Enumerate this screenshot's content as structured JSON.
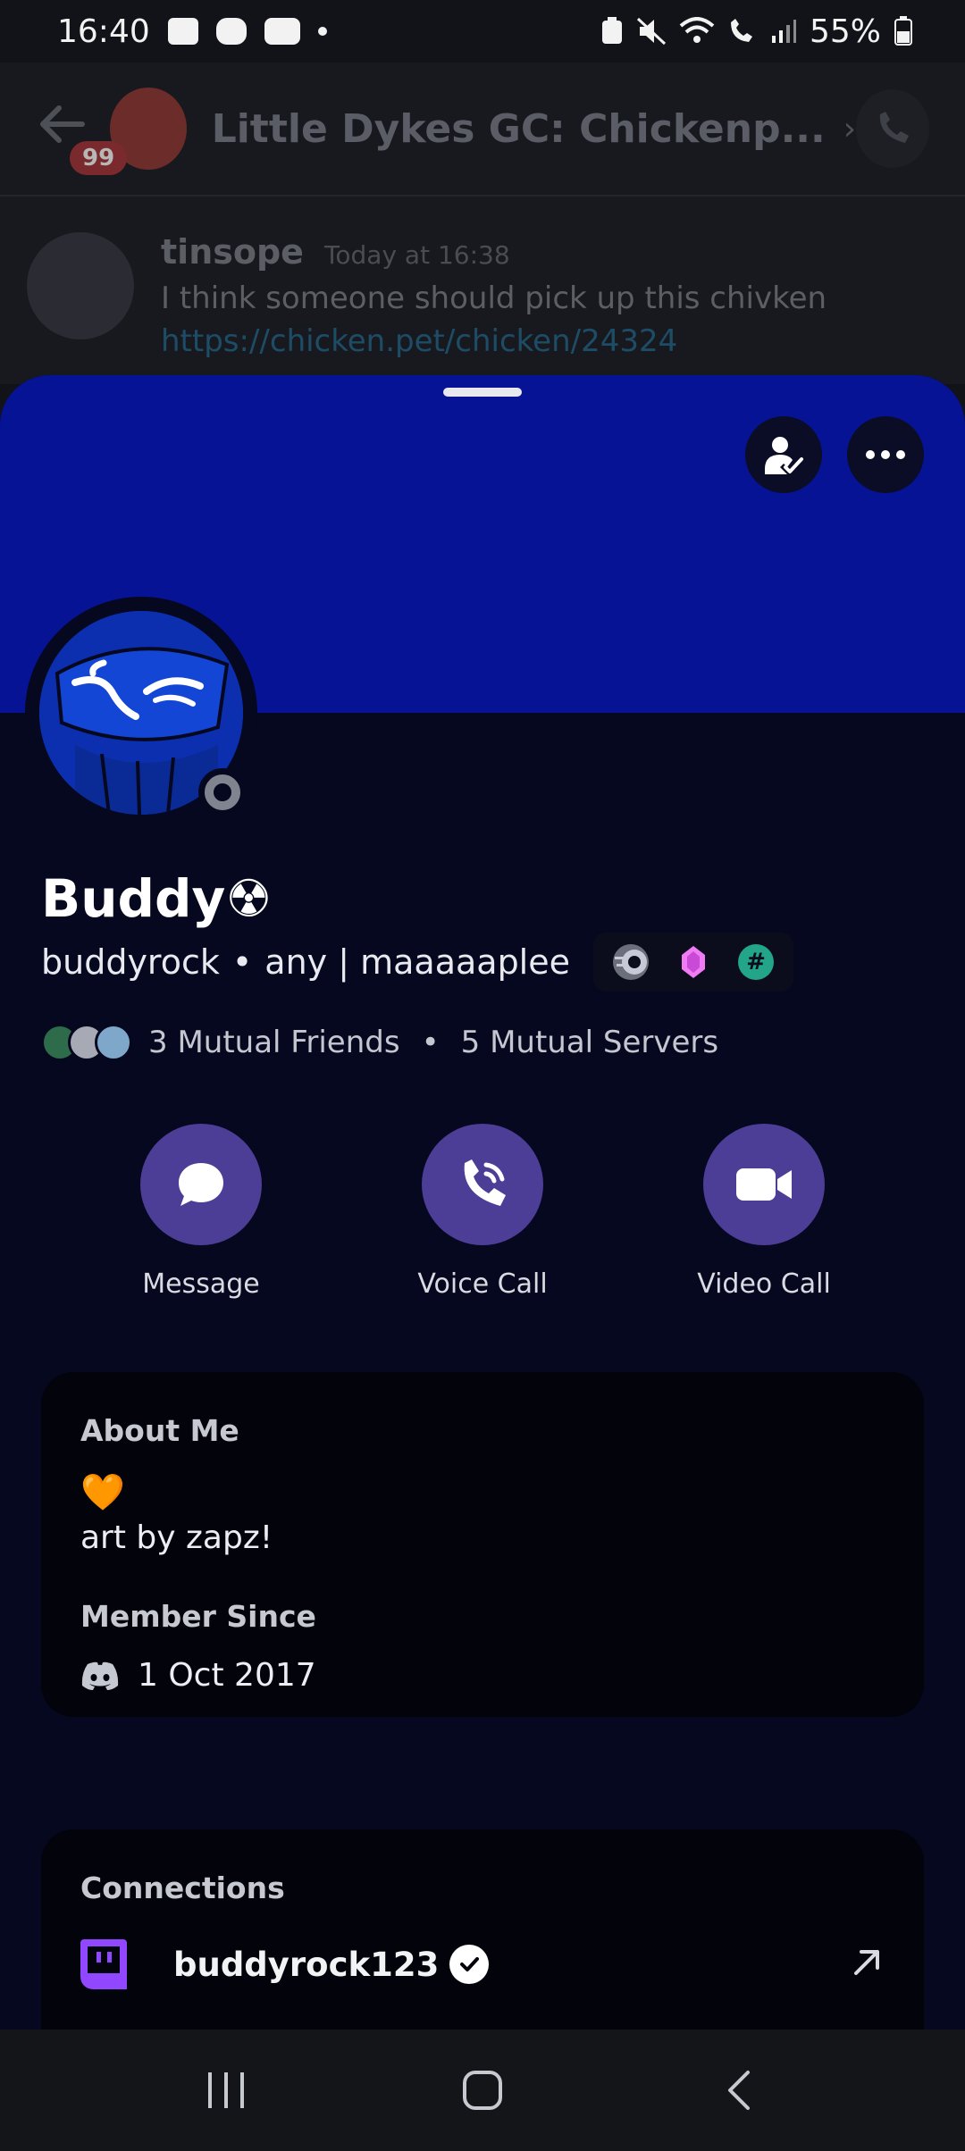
{
  "status_bar": {
    "time": "16:40",
    "battery": "55%"
  },
  "chat": {
    "unread_badge": "99",
    "title": "Little Dykes GC: Chickenp...",
    "message": {
      "author": "tinsope",
      "timestamp": "Today at 16:38",
      "text": "I think someone should pick up this chivken",
      "link": "https://chicken.pet/chicken/24324"
    }
  },
  "profile": {
    "display_name": "Buddy☢",
    "username": "buddyrock",
    "pronouns_sep": "•",
    "pronouns": "any | maaaaaplee",
    "badges": [
      "nitro-badge",
      "boost-gem-badge",
      "hashtag-badge"
    ],
    "mutual_friends": "3 Mutual Friends",
    "mutual_sep": "•",
    "mutual_servers": "5 Mutual Servers",
    "actions": {
      "message": "Message",
      "voice_call": "Voice Call",
      "video_call": "Video Call"
    },
    "about": {
      "title": "About Me",
      "emoji": "🧡",
      "text": "art by zapz!"
    },
    "member_since": {
      "title": "Member Since",
      "date": "1 Oct 2017"
    },
    "connections": {
      "title": "Connections",
      "items": [
        {
          "service": "twitch",
          "name": "buddyrock123",
          "verified": true
        }
      ]
    }
  },
  "colors": {
    "banner": "#061394",
    "sheet": "#05081f",
    "action_button": "#4c3d96",
    "card": "#02030b",
    "twitch": "#9146ff"
  }
}
